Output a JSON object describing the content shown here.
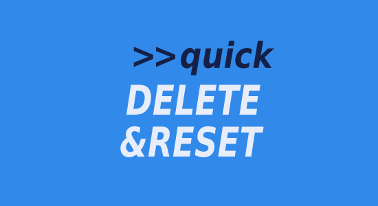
{
  "background_color": "#318aea",
  "logo": {
    "prefix": ">>",
    "line1": "quick",
    "line2": "DELETE",
    "line3": "&RESET",
    "line1_color": "#162047",
    "line2_color": "#e8edfa"
  }
}
